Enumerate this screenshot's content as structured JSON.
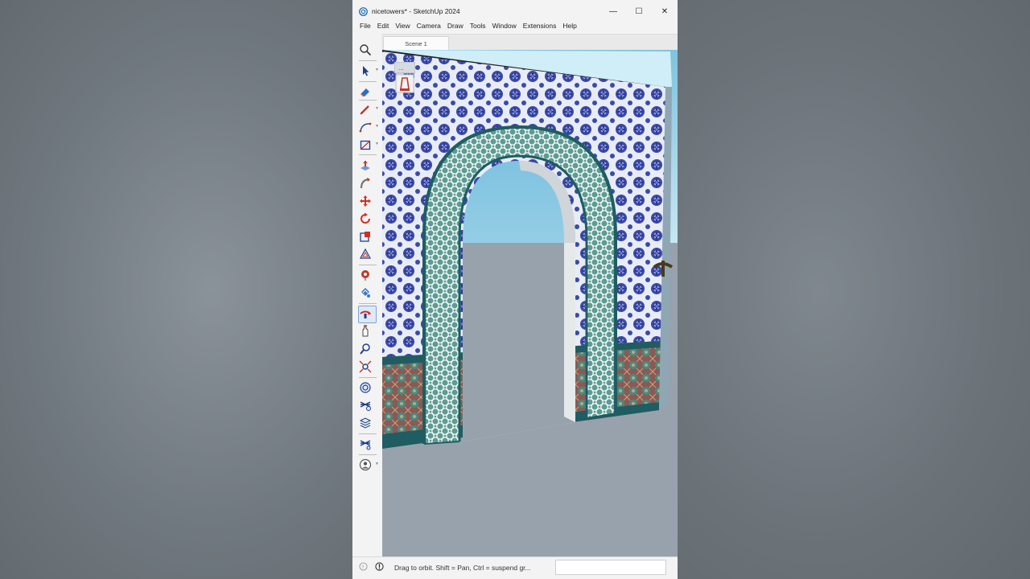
{
  "window": {
    "title": "nicetowers* - SketchUp 2024",
    "controls": {
      "minimize": "—",
      "maximize": "☐",
      "close": "✕"
    }
  },
  "menu": [
    "File",
    "Edit",
    "View",
    "Camera",
    "Draw",
    "Tools",
    "Window",
    "Extensions",
    "Help"
  ],
  "scene_tabs": [
    {
      "label": "Scene 1",
      "active": true
    }
  ],
  "tools": [
    {
      "name": "search-icon",
      "has_menu": false
    },
    {
      "name": "select-icon",
      "has_menu": true
    },
    {
      "name": "eraser-icon",
      "has_menu": false
    },
    {
      "name": "pencil-line-icon",
      "has_menu": true
    },
    {
      "name": "arc-icon",
      "has_menu": true
    },
    {
      "name": "rectangle-icon",
      "has_menu": true
    },
    {
      "name": "push-pull-icon",
      "has_menu": false
    },
    {
      "name": "follow-me-icon",
      "has_menu": false
    },
    {
      "name": "move-icon",
      "has_menu": false
    },
    {
      "name": "rotate-icon",
      "has_menu": false
    },
    {
      "name": "scale-icon",
      "has_menu": false
    },
    {
      "name": "offset-icon",
      "has_menu": false
    },
    {
      "name": "tape-measure-icon",
      "has_menu": false
    },
    {
      "name": "paint-bucket-icon",
      "has_menu": false
    },
    {
      "name": "orbit-icon",
      "has_menu": false,
      "active": true
    },
    {
      "name": "pan-icon",
      "has_menu": false
    },
    {
      "name": "zoom-icon",
      "has_menu": false
    },
    {
      "name": "zoom-extents-icon",
      "has_menu": false
    },
    {
      "name": "warehouse-icon",
      "has_menu": false
    },
    {
      "name": "extension-warehouse-icon",
      "has_menu": false
    },
    {
      "name": "layers-icon",
      "has_menu": false
    },
    {
      "name": "extension-manager-icon",
      "has_menu": false
    },
    {
      "name": "account-icon",
      "has_menu": true
    }
  ],
  "status": {
    "text": "Drag to orbit. Shift = Pan, Ctrl = suspend gr...",
    "measurements_value": ""
  },
  "colors": {
    "tile_blue": "#3b4aa8",
    "tile_light": "#e8ecf6",
    "arch_green": "#4f8f86",
    "sky": "#a9d8ea",
    "ground": "#98a2ad",
    "accent": "#7aa4d6"
  }
}
